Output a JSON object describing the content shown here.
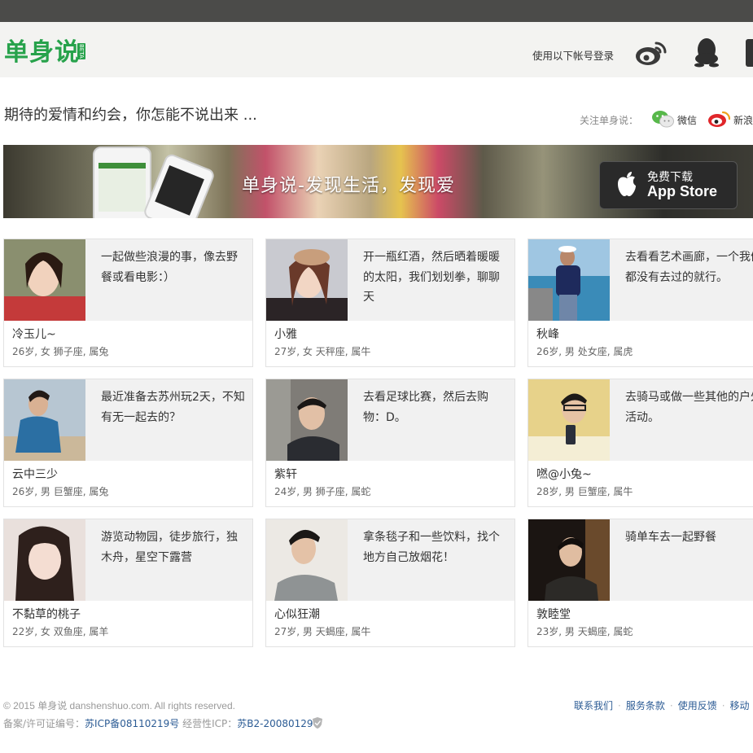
{
  "header": {
    "logo_text": "单身说",
    "beta_badge": "BETA",
    "login_prompt": "使用以下帐号登录",
    "login_icons": [
      "weibo-icon",
      "qq-icon",
      "douban-icon"
    ]
  },
  "intro": {
    "tagline": "期待的爱情和约会，你怎能不说出来 ...",
    "follow_label": "关注单身说：",
    "wechat_label": "微信",
    "sina_label": "新浪"
  },
  "banner": {
    "title": "单身说-发现生活，发现爱",
    "appstore_line1": "免费下载",
    "appstore_line2": "App Store"
  },
  "profiles": [
    {
      "quote": "一起做些浪漫的事，像去野餐或看电影：）",
      "name": "冷玉儿~",
      "info": "26岁, 女   狮子座, 属兔"
    },
    {
      "quote": "开一瓶红酒，然后晒着暖暖的太阳，我们划划拳，聊聊天",
      "name": "小雅",
      "info": "27岁, 女   天秤座, 属牛"
    },
    {
      "quote": "去看看艺术画廊，一个我们都没有去过的就行。",
      "name": "秋峰",
      "info": "26岁, 男   处女座, 属虎"
    },
    {
      "quote": "最近准备去苏州玩2天，不知有无一起去的？",
      "name": "云中三少",
      "info": "26岁, 男   巨蟹座, 属兔"
    },
    {
      "quote": "去看足球比赛，然后去购物：D。",
      "name": "紫轩",
      "info": "24岁, 男   狮子座, 属蛇"
    },
    {
      "quote": "去骑马或做一些其他的户外活动。",
      "name": "嘫@小兔~",
      "info": "28岁, 男   巨蟹座, 属牛"
    },
    {
      "quote": "游览动物园，徒步旅行，独木舟，星空下露营",
      "name": "不黏草的桃子",
      "info": "22岁, 女   双鱼座, 属羊"
    },
    {
      "quote": "拿条毯子和一些饮料，找个地方自己放烟花！",
      "name": "心似狂潮",
      "info": "27岁, 男   天蝎座, 属牛"
    },
    {
      "quote": "骑单车去一起野餐",
      "name": "敦睦堂",
      "info": "23岁, 男   天蝎座, 属蛇"
    }
  ],
  "footer": {
    "copyright": "© 2015 单身说 danshenshuo.com. All rights reserved.",
    "icp_label": "备案/许可证编号：",
    "icp_number": "苏ICP备08110219号",
    "business_label": "经营性ICP：",
    "business_number": "苏B2-20080129",
    "links": [
      "联系我们",
      "服务条款",
      "使用反馈",
      "移动"
    ]
  },
  "colors": {
    "brand_green": "#27a24b",
    "top_bar": "#4b4b49",
    "header_bg": "#f3f3f1",
    "link_blue": "#2b5b94"
  }
}
